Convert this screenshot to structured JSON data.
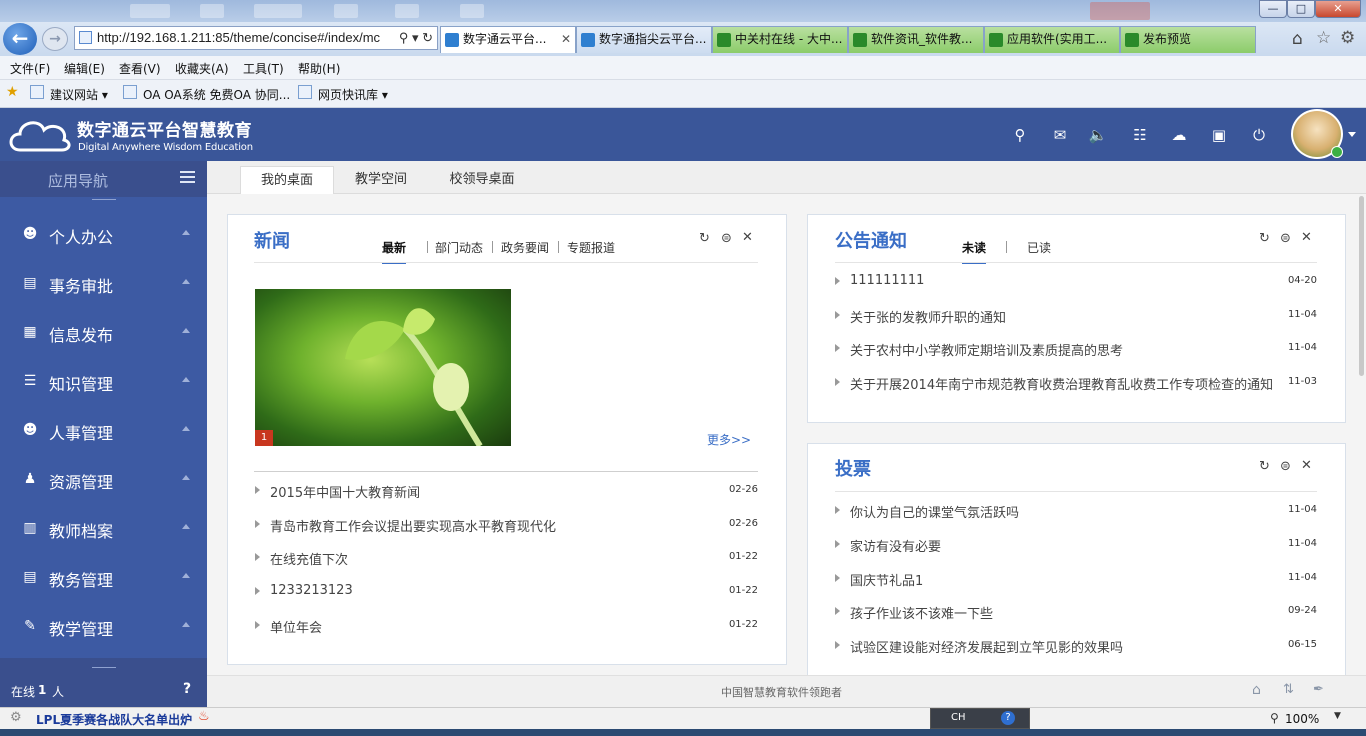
{
  "browser": {
    "address": "http://192.168.1.211:85/theme/concise#/index/mc",
    "tabs": [
      {
        "label": "数字通云平台...",
        "active": true
      },
      {
        "label": "数字通指尖云平台..."
      },
      {
        "label": "中关村在线 - 大中..."
      },
      {
        "label": "软件资讯_软件教..."
      },
      {
        "label": "应用软件(实用工..."
      },
      {
        "label": "发布预览"
      }
    ],
    "menu": [
      "文件(F)",
      "编辑(E)",
      "查看(V)",
      "收藏夹(A)",
      "工具(T)",
      "帮助(H)"
    ],
    "favorites": [
      "建议网站 ▾",
      "OA OA系统 免费OA 协同...",
      "网页快讯库 ▾"
    ],
    "status_news": "LPL夏季赛各战队大名单出炉",
    "ime": "CH",
    "zoom": "100%"
  },
  "header": {
    "brand_cn": "数字通云平台智慧教育",
    "brand_en": "Digital Anywhere Wisdom Education"
  },
  "sidebar": {
    "title": "应用导航",
    "items": [
      {
        "label": "个人办公"
      },
      {
        "label": "事务审批"
      },
      {
        "label": "信息发布"
      },
      {
        "label": "知识管理"
      },
      {
        "label": "人事管理"
      },
      {
        "label": "资源管理"
      },
      {
        "label": "教师档案"
      },
      {
        "label": "教务管理"
      },
      {
        "label": "教学管理"
      }
    ],
    "online_prefix": "在线",
    "online_count": "1",
    "online_suffix": "人",
    "help": "?"
  },
  "toptabs": [
    "我的桌面",
    "教学空间",
    "校领导桌面"
  ],
  "news": {
    "title": "新闻",
    "tabs": [
      "最新",
      "部门动态",
      "政务要闻",
      "专题报道"
    ],
    "image_index": "1",
    "more": "更多>>",
    "items": [
      {
        "text": "2015年中国十大教育新闻",
        "date": "02-26"
      },
      {
        "text": "青岛市教育工作会议提出要实现高水平教育现代化",
        "date": "02-26"
      },
      {
        "text": "在线充值下次",
        "date": "01-22"
      },
      {
        "text": "1233213123",
        "date": "01-22"
      },
      {
        "text": "单位年会",
        "date": "01-22"
      }
    ]
  },
  "notice": {
    "title": "公告通知",
    "tabs": [
      "未读",
      "已读"
    ],
    "items": [
      {
        "text": "111111111",
        "date": "04-20"
      },
      {
        "text": "关于张的发教师升职的通知",
        "date": "11-04"
      },
      {
        "text": "关于农村中小学教师定期培训及素质提高的思考",
        "date": "11-04"
      },
      {
        "text": "关于开展2014年南宁市规范教育收费治理教育乱收费工作专项检查的通知",
        "date": "11-03"
      }
    ]
  },
  "vote": {
    "title": "投票",
    "items": [
      {
        "text": "你认为自己的课堂气氛活跃吗",
        "date": "11-04"
      },
      {
        "text": "家访有没有必要",
        "date": "11-04"
      },
      {
        "text": "国庆节礼品1",
        "date": "11-04"
      },
      {
        "text": "孩子作业该不该难一下些",
        "date": "09-24"
      },
      {
        "text": "试验区建设能对经济发展起到立竿见影的效果吗",
        "date": "06-15"
      }
    ]
  },
  "footer": {
    "slogan": "中国智慧教育软件领跑者"
  },
  "colors": {
    "header": "#3a5699",
    "sidebar": "#3d5aa3",
    "accent": "#3a6ec6"
  }
}
